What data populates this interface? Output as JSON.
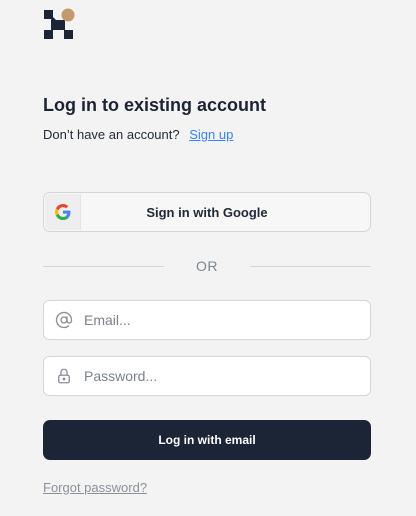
{
  "brand": {
    "logo_icon": "brand-logo-icon",
    "colors": {
      "navy": "#1b2536",
      "accent": "#c59a6b"
    }
  },
  "heading": {
    "title": "Log in to existing account",
    "signup_prompt": "Don’t have an account?",
    "signup_link": "Sign up"
  },
  "google": {
    "label": "Sign in with Google",
    "icon": "google-icon"
  },
  "divider": {
    "text": "OR"
  },
  "form": {
    "email": {
      "placeholder": "Email...",
      "value": "",
      "icon": "at-sign-icon"
    },
    "password": {
      "placeholder": "Password...",
      "value": "",
      "icon": "lock-icon"
    },
    "submit_label": "Log in with email",
    "forgot_label": "Forgot password?"
  },
  "colors": {
    "background": "#f3f3f3",
    "primary_button": "#1b2536",
    "link": "#3b82f6",
    "muted": "#7c8591"
  }
}
